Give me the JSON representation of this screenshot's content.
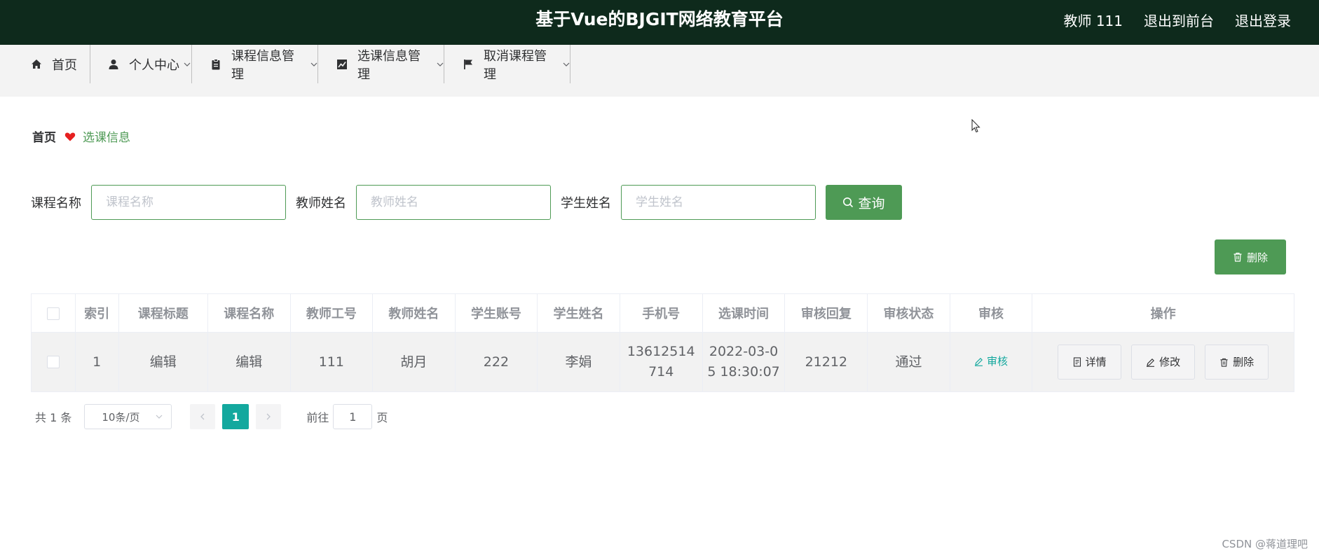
{
  "header": {
    "title": "基于Vue的BJGIT网络教育平台",
    "user": "教师 111",
    "to_front": "退出到前台",
    "logout": "退出登录"
  },
  "nav": {
    "items": [
      {
        "label": "首页",
        "icon": "home-icon"
      },
      {
        "label": "个人中心",
        "icon": "user-icon"
      },
      {
        "label": "课程信息管理",
        "icon": "clipboard-icon"
      },
      {
        "label": "选课信息管理",
        "icon": "chart-icon"
      },
      {
        "label": "取消课程管理",
        "icon": "flag-icon"
      }
    ]
  },
  "breadcrumb": {
    "home": "首页",
    "current": "选课信息"
  },
  "search": {
    "course_label": "课程名称",
    "course_placeholder": "课程名称",
    "teacher_label": "教师姓名",
    "teacher_placeholder": "教师姓名",
    "student_label": "学生姓名",
    "student_placeholder": "学生姓名",
    "query_label": "查询"
  },
  "toolbar": {
    "delete_label": "删除"
  },
  "table": {
    "headers": [
      "索引",
      "课程标题",
      "课程名称",
      "教师工号",
      "教师姓名",
      "学生账号",
      "学生姓名",
      "手机号",
      "选课时间",
      "审核回复",
      "审核状态",
      "审核",
      "操作"
    ],
    "rows": [
      {
        "index": "1",
        "course_title": "编辑",
        "course_name": "编辑",
        "teacher_id": "111",
        "teacher_name": "胡月",
        "student_account": "222",
        "student_name": "李娟",
        "phone_line1": "13612514",
        "phone_line2": "714",
        "time_line1": "2022-03-0",
        "time_line2": "5 18:30:07",
        "reply": "21212",
        "status": "通过",
        "audit_label": "审核",
        "detail_label": "详情",
        "edit_label": "修改",
        "delete_label": "删除"
      }
    ]
  },
  "pagination": {
    "total": "共 1 条",
    "page_size": "10条/页",
    "current_page": "1",
    "goto_prefix": "前往",
    "goto_value": "1",
    "goto_suffix": "页"
  },
  "watermark": "CSDN @蒋道理吧",
  "colors": {
    "header_bg": "#0e2a1c",
    "accent": "#4e9a55",
    "teal": "#13a89e",
    "heart": "#e62020"
  }
}
